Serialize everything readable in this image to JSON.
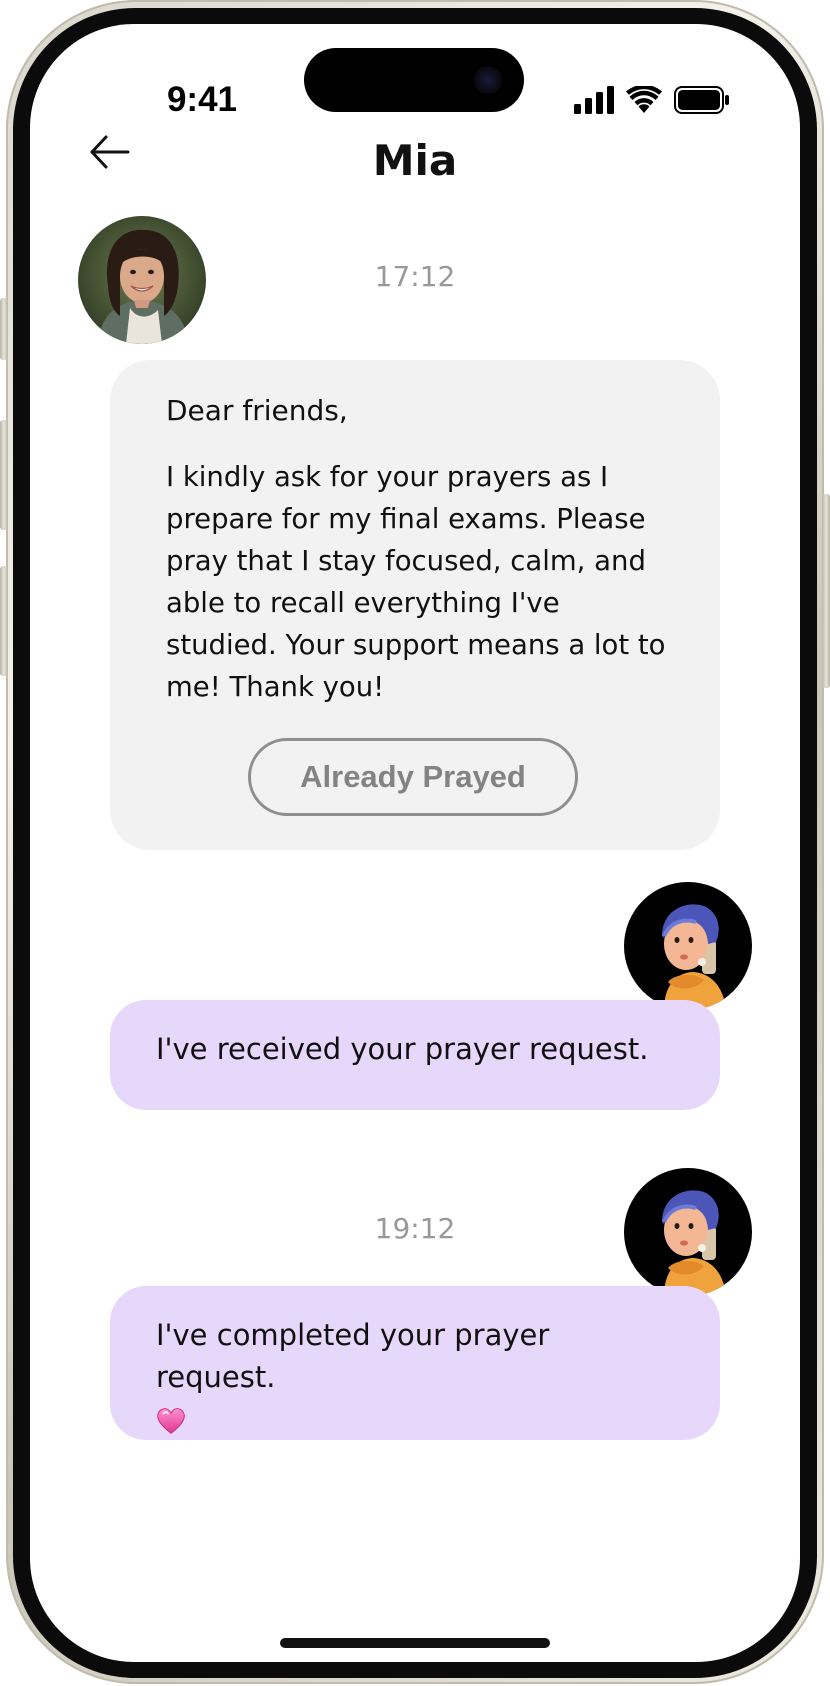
{
  "status_bar": {
    "time": "9:41"
  },
  "header": {
    "title": "Mia",
    "back_icon": "arrow-left-icon"
  },
  "messages": [
    {
      "sender": "Mia",
      "timestamp": "17:12",
      "greeting": "Dear friends,",
      "body": "I kindly ask for your prayers as I prepare for my final exams. Please pray that I stay focused, calm, and able to recall everything I've studied. Your support means a lot to me! Thank you!",
      "action_label": "Already Prayed"
    },
    {
      "sender": "me",
      "text": "I've received your prayer request."
    },
    {
      "sender": "me",
      "timestamp": "19:12",
      "text": "I've completed your prayer request.",
      "emoji_icon": "pink-heart-icon"
    }
  ],
  "colors": {
    "incoming_bubble": "#f2f2f2",
    "outgoing_bubble": "#e7d8fb",
    "timestamp": "#999999",
    "button_border": "#8f8f8f"
  }
}
